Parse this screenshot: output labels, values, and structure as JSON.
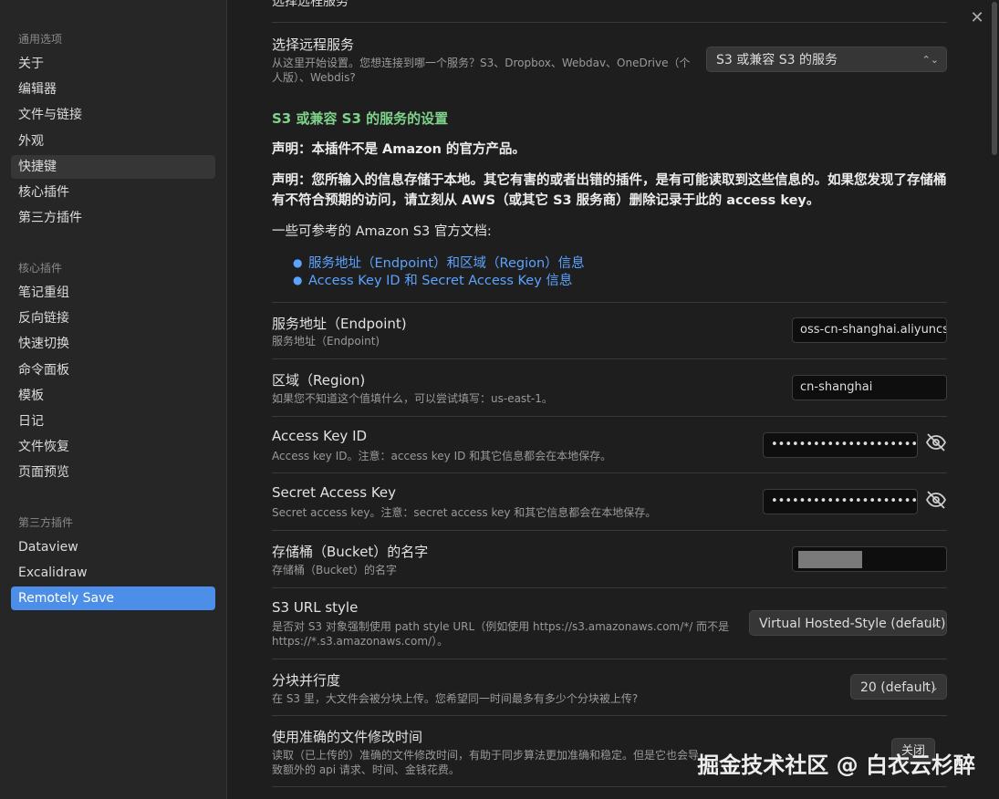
{
  "sidebar": {
    "groups": [
      {
        "title": "通用选项",
        "items": [
          "关于",
          "编辑器",
          "文件与链接",
          "外观",
          "快捷键",
          "核心插件",
          "第三方插件"
        ]
      },
      {
        "title": "核心插件",
        "items": [
          "笔记重组",
          "反向链接",
          "快速切换",
          "命令面板",
          "模板",
          "日记",
          "文件恢复",
          "页面预览"
        ]
      },
      {
        "title": "第三方插件",
        "items": [
          "Dataview",
          "Excalidraw",
          "Remotely Save"
        ]
      }
    ]
  },
  "content": {
    "cut_heading": "选择远程服务",
    "remote_service": {
      "name": "选择远程服务",
      "desc": "从这里开始设置。您想连接到哪一个服务？S3、Dropbox、Webdav、OneDrive（个人版）、Webdis?",
      "selected": "S3 或兼容 S3 的服务"
    },
    "s3_title": "S3 或兼容 S3 的服务的设置",
    "disclaimer1": "声明：本插件不是 Amazon 的官方产品。",
    "disclaimer2": "声明：您所输入的信息存储于本地。其它有害的或者出错的插件，是有可能读取到这些信息的。如果您发现了存储桶有不符合预期的访问，请立刻从 AWS（或其它 S3 服务商）删除记录于此的 access key。",
    "docs_intro": "一些可参考的 Amazon S3 官方文档:",
    "doc_links": [
      "服务地址（Endpoint）和区域（Region）信息",
      "Access Key ID 和 Secret Access Key 信息"
    ],
    "endpoint": {
      "name": "服务地址（Endpoint)",
      "desc": "服务地址（Endpoint)",
      "value": "oss-cn-shanghai.aliyuncs.com"
    },
    "region": {
      "name": "区域（Region)",
      "desc": "如果您不知道这个值填什么，可以尝试填写：us-east-1。",
      "value": "cn-shanghai"
    },
    "access_key": {
      "name": "Access Key ID",
      "desc": "Access key ID。注意：access key ID 和其它信息都会在本地保存。",
      "value": "••••••••••••••••••••••••"
    },
    "secret_key": {
      "name": "Secret Access Key",
      "desc": "Secret access key。注意：secret access key 和其它信息都会在本地保存。",
      "value": "••••••••••••••••••••••••••••"
    },
    "bucket": {
      "name": "存储桶（Bucket）的名字",
      "desc": "存储桶（Bucket）的名字"
    },
    "url_style": {
      "name": "S3 URL style",
      "desc": "是否对 S3 对象强制使用 path style URL（例如使用 https://s3.amazonaws.com/*/ 而不是 https://*.s3.amazonaws.com/）。",
      "selected": "Virtual Hosted-Style (default)"
    },
    "parallel": {
      "name": "分块并行度",
      "desc": "在 S3 里，大文件会被分块上传。您希望同一时间最多有多少个分块被上传?",
      "selected": "20 (default)"
    },
    "accurate_mtime": {
      "name": "使用准确的文件修改时间",
      "desc": "读取（已上传的）准确的文件修改时间，有助于同步算法更加准确和稳定。但是它也会导致额外的 api 请求、时间、金钱花费。",
      "button": "关闭"
    }
  },
  "watermark": "掘金技术社区 @ 白衣云杉醉",
  "colors": {
    "accent": "#4c8ee8",
    "section_title": "#7ed38a",
    "link": "#5ca3ff"
  }
}
